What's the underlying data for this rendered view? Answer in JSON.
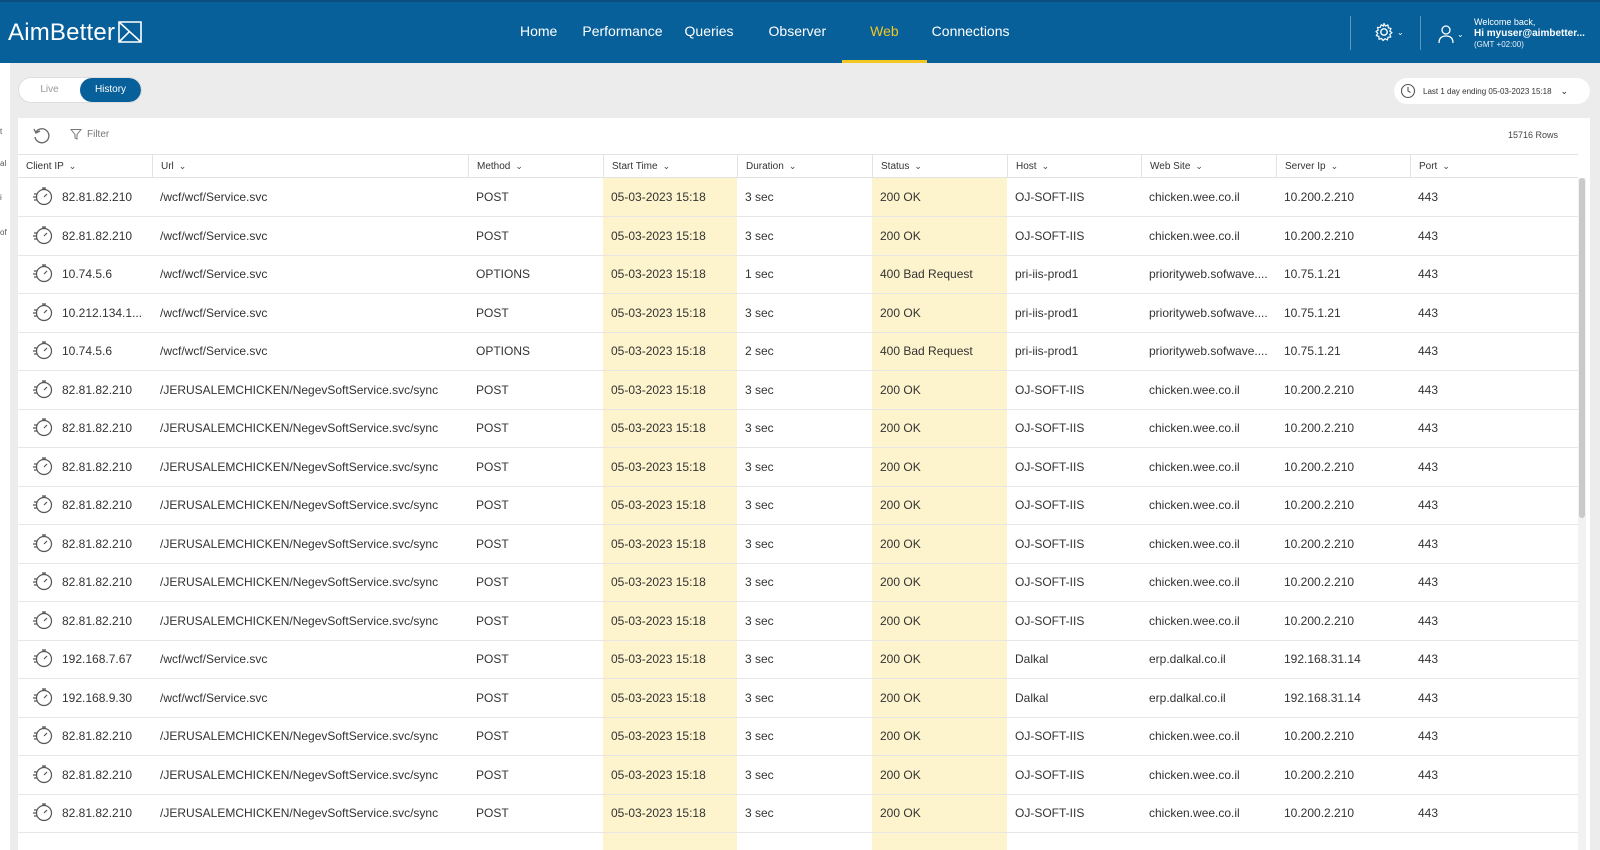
{
  "header": {
    "logo_text": "AimBetter",
    "nav": [
      {
        "label": "Home"
      },
      {
        "label": "Performance"
      },
      {
        "label": "Queries"
      },
      {
        "label": "Observer"
      },
      {
        "label": "Web"
      },
      {
        "label": "Connections"
      }
    ],
    "active_tab": "Web",
    "welcome": "Welcome back,",
    "user": "Hi myuser@aimbetter...",
    "timezone": "(GMT +02:00)"
  },
  "left_strip": [
    "t",
    "al",
    "i",
    "of"
  ],
  "mode_toggle": {
    "live": "Live",
    "history": "History",
    "selected": "History"
  },
  "date_range": {
    "label": "Last 1 day ending  05-03-2023 15:18"
  },
  "toolbar": {
    "filter": "Filter",
    "row_count": "15716 Rows"
  },
  "columns": [
    "Client IP",
    "Url",
    "Method",
    "Start Time",
    "Duration",
    "Status",
    "Host",
    "Web Site",
    "Server Ip",
    "Port"
  ],
  "rows": [
    [
      "82.81.82.210",
      "/wcf/wcf/Service.svc",
      "POST",
      "05-03-2023 15:18",
      "3 sec",
      "200 OK",
      "OJ-SOFT-IIS",
      "chicken.wee.co.il",
      "10.200.2.210",
      "443"
    ],
    [
      "82.81.82.210",
      "/wcf/wcf/Service.svc",
      "POST",
      "05-03-2023 15:18",
      "3 sec",
      "200 OK",
      "OJ-SOFT-IIS",
      "chicken.wee.co.il",
      "10.200.2.210",
      "443"
    ],
    [
      "10.74.5.6",
      "/wcf/wcf/Service.svc",
      "OPTIONS",
      "05-03-2023 15:18",
      "1 sec",
      "400 Bad Request",
      "pri-iis-prod1",
      "priorityweb.sofwave....",
      "10.75.1.21",
      "443"
    ],
    [
      "10.212.134.1...",
      "/wcf/wcf/Service.svc",
      "POST",
      "05-03-2023 15:18",
      "3 sec",
      "200 OK",
      "pri-iis-prod1",
      "priorityweb.sofwave....",
      "10.75.1.21",
      "443"
    ],
    [
      "10.74.5.6",
      "/wcf/wcf/Service.svc",
      "OPTIONS",
      "05-03-2023 15:18",
      "2 sec",
      "400 Bad Request",
      "pri-iis-prod1",
      "priorityweb.sofwave....",
      "10.75.1.21",
      "443"
    ],
    [
      "82.81.82.210",
      "/JERUSALEMCHICKEN/NegevSoftService.svc/sync",
      "POST",
      "05-03-2023 15:18",
      "3 sec",
      "200 OK",
      "OJ-SOFT-IIS",
      "chicken.wee.co.il",
      "10.200.2.210",
      "443"
    ],
    [
      "82.81.82.210",
      "/JERUSALEMCHICKEN/NegevSoftService.svc/sync",
      "POST",
      "05-03-2023 15:18",
      "3 sec",
      "200 OK",
      "OJ-SOFT-IIS",
      "chicken.wee.co.il",
      "10.200.2.210",
      "443"
    ],
    [
      "82.81.82.210",
      "/JERUSALEMCHICKEN/NegevSoftService.svc/sync",
      "POST",
      "05-03-2023 15:18",
      "3 sec",
      "200 OK",
      "OJ-SOFT-IIS",
      "chicken.wee.co.il",
      "10.200.2.210",
      "443"
    ],
    [
      "82.81.82.210",
      "/JERUSALEMCHICKEN/NegevSoftService.svc/sync",
      "POST",
      "05-03-2023 15:18",
      "3 sec",
      "200 OK",
      "OJ-SOFT-IIS",
      "chicken.wee.co.il",
      "10.200.2.210",
      "443"
    ],
    [
      "82.81.82.210",
      "/JERUSALEMCHICKEN/NegevSoftService.svc/sync",
      "POST",
      "05-03-2023 15:18",
      "3 sec",
      "200 OK",
      "OJ-SOFT-IIS",
      "chicken.wee.co.il",
      "10.200.2.210",
      "443"
    ],
    [
      "82.81.82.210",
      "/JERUSALEMCHICKEN/NegevSoftService.svc/sync",
      "POST",
      "05-03-2023 15:18",
      "3 sec",
      "200 OK",
      "OJ-SOFT-IIS",
      "chicken.wee.co.il",
      "10.200.2.210",
      "443"
    ],
    [
      "82.81.82.210",
      "/JERUSALEMCHICKEN/NegevSoftService.svc/sync",
      "POST",
      "05-03-2023 15:18",
      "3 sec",
      "200 OK",
      "OJ-SOFT-IIS",
      "chicken.wee.co.il",
      "10.200.2.210",
      "443"
    ],
    [
      "192.168.7.67",
      "/wcf/wcf/Service.svc",
      "POST",
      "05-03-2023 15:18",
      "3 sec",
      "200 OK",
      "Dalkal",
      "erp.dalkal.co.il",
      "192.168.31.14",
      "443"
    ],
    [
      "192.168.9.30",
      "/wcf/wcf/Service.svc",
      "POST",
      "05-03-2023 15:18",
      "3 sec",
      "200 OK",
      "Dalkal",
      "erp.dalkal.co.il",
      "192.168.31.14",
      "443"
    ],
    [
      "82.81.82.210",
      "/JERUSALEMCHICKEN/NegevSoftService.svc/sync",
      "POST",
      "05-03-2023 15:18",
      "3 sec",
      "200 OK",
      "OJ-SOFT-IIS",
      "chicken.wee.co.il",
      "10.200.2.210",
      "443"
    ],
    [
      "82.81.82.210",
      "/JERUSALEMCHICKEN/NegevSoftService.svc/sync",
      "POST",
      "05-03-2023 15:18",
      "3 sec",
      "200 OK",
      "OJ-SOFT-IIS",
      "chicken.wee.co.il",
      "10.200.2.210",
      "443"
    ],
    [
      "82.81.82.210",
      "/JERUSALEMCHICKEN/NegevSoftService.svc/sync",
      "POST",
      "05-03-2023 15:18",
      "3 sec",
      "200 OK",
      "OJ-SOFT-IIS",
      "chicken.wee.co.il",
      "10.200.2.210",
      "443"
    ]
  ],
  "colors": {
    "header_bg": "#07609a",
    "accent": "#f3c623",
    "highlight": "#fdf3cc"
  }
}
